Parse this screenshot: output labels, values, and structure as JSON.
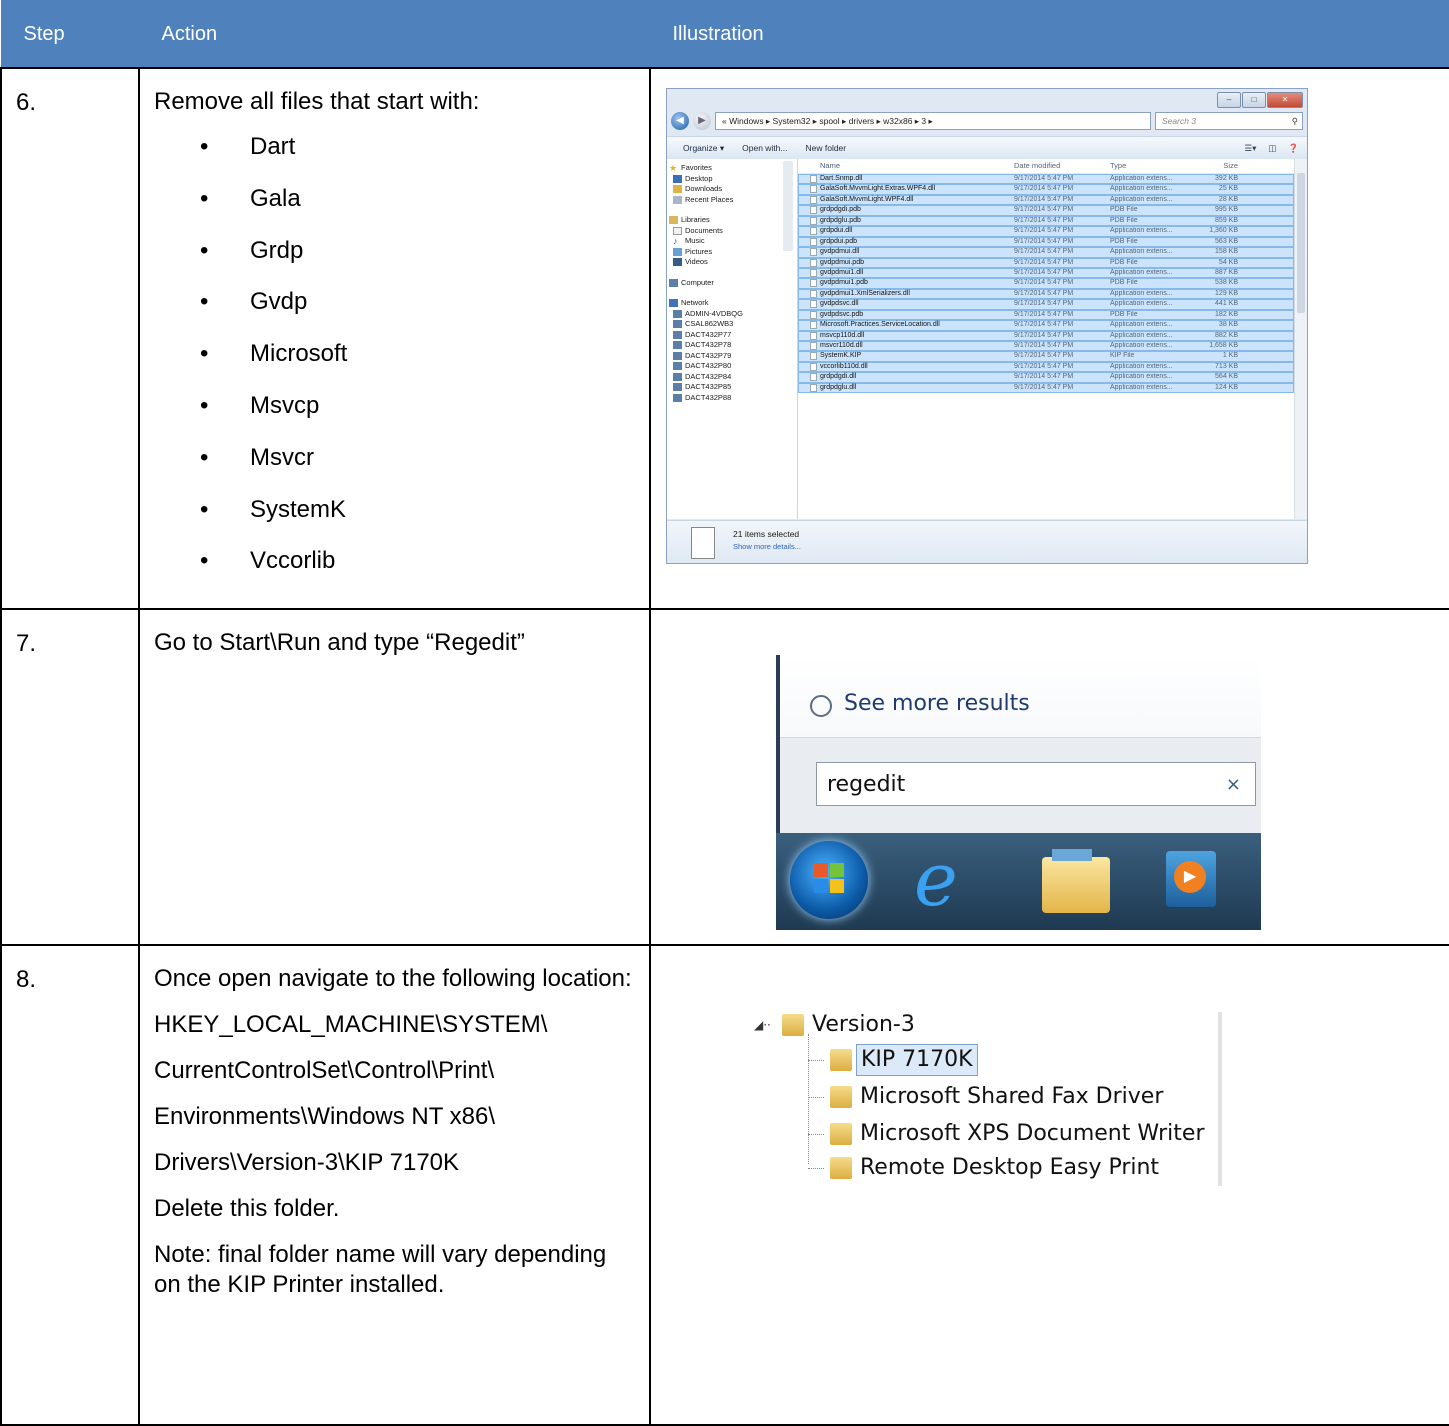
{
  "table": {
    "headers": {
      "step": "Step",
      "action": "Action",
      "illustration": "Illustration"
    },
    "rows": [
      {
        "step": "6.",
        "action_intro": "Remove all files that start with:",
        "bullets": [
          "Dart",
          "Gala",
          "Grdp",
          "Gvdp",
          "Microsoft",
          "Msvcp",
          "Msvcr",
          "SystemK",
          "Vccorlib"
        ]
      },
      {
        "step": "7.",
        "action": "Go to Start\\Run and type “Regedit”"
      },
      {
        "step": "8.",
        "action_lines": [
          "Once open navigate to the following location:",
          "HKEY_LOCAL_MACHINE\\SYSTEM\\",
          "CurrentControlSet\\Control\\Print\\",
          "Environments\\Windows NT x86\\",
          "Drivers\\Version-3\\KIP 7170K",
          "Delete this folder.",
          "Note: final folder name will vary depending on the KIP Printer installed."
        ]
      }
    ]
  },
  "explorer": {
    "breadcrumb": "« Windows ▸ System32 ▸ spool ▸ drivers ▸ w32x86 ▸ 3 ▸",
    "search_placeholder": "Search 3",
    "toolbar": {
      "organize": "Organize ▾",
      "open_with": "Open with...",
      "new_folder": "New folder"
    },
    "nav": {
      "favorites": "Favorites",
      "favorites_items": [
        "Desktop",
        "Downloads",
        "Recent Places"
      ],
      "libraries": "Libraries",
      "libraries_items": [
        "Documents",
        "Music",
        "Pictures",
        "Videos"
      ],
      "computer": "Computer",
      "network": "Network",
      "network_items": [
        "ADMIN-4VDBQG",
        "CSAL862WB3",
        "DACT432P77",
        "DACT432P78",
        "DACT432P79",
        "DACT432P80",
        "DACT432P84",
        "DACT432P85",
        "DACT432P88"
      ]
    },
    "columns": {
      "name": "Name",
      "date": "Date modified",
      "type": "Type",
      "size": "Size"
    },
    "files": [
      {
        "name": "Dart.Snmp.dll",
        "date": "9/17/2014 5:47 PM",
        "type": "Application extens...",
        "size": "392 KB"
      },
      {
        "name": "GalaSoft.MvvmLight.Extras.WPF4.dll",
        "date": "9/17/2014 5:47 PM",
        "type": "Application extens...",
        "size": "25 KB"
      },
      {
        "name": "GalaSoft.MvvmLight.WPF4.dll",
        "date": "9/17/2014 5:47 PM",
        "type": "Application extens...",
        "size": "28 KB"
      },
      {
        "name": "grdpdgdi.pdb",
        "date": "9/17/2014 5:47 PM",
        "type": "PDB File",
        "size": "995 KB"
      },
      {
        "name": "grdpdglu.pdb",
        "date": "9/17/2014 5:47 PM",
        "type": "PDB File",
        "size": "859 KB"
      },
      {
        "name": "grdpdui.dll",
        "date": "9/17/2014 5:47 PM",
        "type": "Application extens...",
        "size": "1,360 KB"
      },
      {
        "name": "grdpdui.pdb",
        "date": "9/17/2014 5:47 PM",
        "type": "PDB File",
        "size": "563 KB"
      },
      {
        "name": "gvdpdmui.dll",
        "date": "9/17/2014 5:47 PM",
        "type": "Application extens...",
        "size": "158 KB"
      },
      {
        "name": "gvdpdmui.pdb",
        "date": "9/17/2014 5:47 PM",
        "type": "PDB File",
        "size": "54 KB"
      },
      {
        "name": "gvdpdmui1.dll",
        "date": "9/17/2014 5:47 PM",
        "type": "Application extens...",
        "size": "887 KB"
      },
      {
        "name": "gvdpdmui1.pdb",
        "date": "9/17/2014 5:47 PM",
        "type": "PDB File",
        "size": "538 KB"
      },
      {
        "name": "gvdpdmui1.XmlSerializers.dll",
        "date": "9/17/2014 5:47 PM",
        "type": "Application extens...",
        "size": "129 KB"
      },
      {
        "name": "gvdpdsvc.dll",
        "date": "9/17/2014 5:47 PM",
        "type": "Application extens...",
        "size": "441 KB"
      },
      {
        "name": "gvdpdsvc.pdb",
        "date": "9/17/2014 5:47 PM",
        "type": "PDB File",
        "size": "182 KB"
      },
      {
        "name": "Microsoft.Practices.ServiceLocation.dll",
        "date": "9/17/2014 5:47 PM",
        "type": "Application extens...",
        "size": "38 KB"
      },
      {
        "name": "msvcp110d.dll",
        "date": "9/17/2014 5:47 PM",
        "type": "Application extens...",
        "size": "882 KB"
      },
      {
        "name": "msvcr110d.dll",
        "date": "9/17/2014 5:47 PM",
        "type": "Application extens...",
        "size": "1,658 KB"
      },
      {
        "name": "SystemK.KIP",
        "date": "9/17/2014 5:47 PM",
        "type": "KIP File",
        "size": "1 KB"
      },
      {
        "name": "vccorlib110d.dll",
        "date": "9/17/2014 5:47 PM",
        "type": "Application extens...",
        "size": "713 KB"
      },
      {
        "name": "grdpdgdi.dll",
        "date": "9/17/2014 5:47 PM",
        "type": "Application extens...",
        "size": "564 KB"
      },
      {
        "name": "grdpdglu.dll",
        "date": "9/17/2014 5:47 PM",
        "type": "Application extens...",
        "size": "124 KB"
      }
    ],
    "details": {
      "selected": "21 items selected",
      "more": "Show more details..."
    }
  },
  "startmenu": {
    "see_more": "See more results",
    "search_value": "regedit",
    "clear": "×"
  },
  "registry": {
    "parent": "Version-3",
    "children": [
      "KIP 7170K",
      "Microsoft Shared Fax Driver",
      "Microsoft XPS Document Writer",
      "Remote Desktop Easy Print"
    ]
  }
}
